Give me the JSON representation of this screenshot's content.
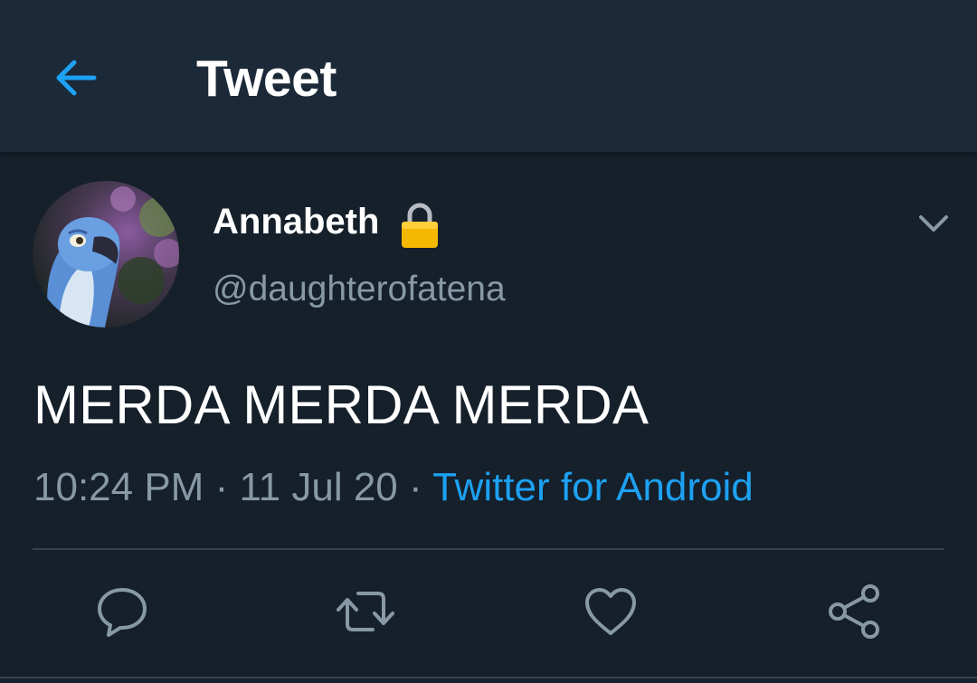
{
  "header": {
    "title": "Tweet",
    "back_icon": "arrow-left-icon",
    "accent_color": "#1da1f2"
  },
  "tweet": {
    "author": {
      "display_name": "Annabeth",
      "handle": "@daughterofatena",
      "protected_icon": "lock-icon"
    },
    "text": "MERDA MERDA MERDA",
    "time": "10:24 PM",
    "date": "11 Jul 20",
    "separator": "·",
    "source": "Twitter for Android"
  },
  "actions": [
    {
      "name": "reply",
      "icon": "reply-icon"
    },
    {
      "name": "retweet",
      "icon": "retweet-icon"
    },
    {
      "name": "like",
      "icon": "heart-icon"
    },
    {
      "name": "share",
      "icon": "share-icon"
    }
  ],
  "colors": {
    "background": "#15202b",
    "topbar": "#1c2938",
    "secondary_text": "#8899a6",
    "link": "#1da1f2"
  }
}
